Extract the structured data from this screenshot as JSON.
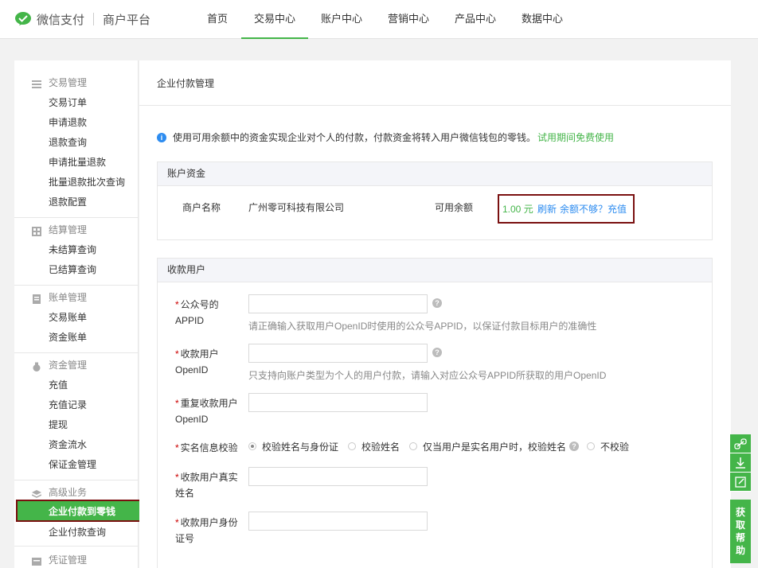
{
  "brand": {
    "name": "微信支付",
    "sub": "商户平台",
    "accent": "#44b549"
  },
  "nav": [
    "首页",
    "交易中心",
    "账户中心",
    "营销中心",
    "产品中心",
    "数据中心"
  ],
  "nav_active": "交易中心",
  "sidebar": {
    "groups": [
      {
        "title": "交易管理",
        "icon": "list-icon",
        "items": [
          "交易订单",
          "申请退款",
          "退款查询",
          "申请批量退款",
          "批量退款批次查询",
          "退款配置"
        ]
      },
      {
        "title": "结算管理",
        "icon": "grid-icon",
        "items": [
          "未结算查询",
          "已结算查询"
        ]
      },
      {
        "title": "账单管理",
        "icon": "bill-icon",
        "items": [
          "交易账单",
          "资金账单"
        ]
      },
      {
        "title": "资金管理",
        "icon": "money-bag-icon",
        "items": [
          "充值",
          "充值记录",
          "提现",
          "资金流水",
          "保证金管理"
        ]
      },
      {
        "title": "高级业务",
        "icon": "layers-icon",
        "items": [
          "企业付款到零钱",
          "企业付款查询"
        ]
      },
      {
        "title": "凭证管理",
        "icon": "voucher-icon",
        "items": []
      }
    ],
    "active_item": "企业付款到零钱"
  },
  "main": {
    "title": "企业付款管理",
    "info_text": "使用可用余额中的资金实现企业对个人的付款，付款资金将转入用户微信钱包的零钱。",
    "info_link": "试用期间免费使用",
    "account_panel": {
      "title": "账户资金",
      "merchant_label": "商户名称",
      "merchant_value": "广州零可科技有限公司",
      "balance_label": "可用余额",
      "balance_value": "1.00 元",
      "refresh": "刷新",
      "topup": "余额不够？充值"
    },
    "payee_panel": {
      "title": "收款用户",
      "fields": {
        "appid": {
          "label": "公众号的APPID",
          "hint": "请正确输入获取用户OpenID时使用的公众号APPID，以保证付款目标用户的准确性"
        },
        "openid": {
          "label": "收款用户OpenID",
          "hint": "只支持向账户类型为个人的用户付款，请输入对应公众号APPID所获取的用户OpenID"
        },
        "openid_repeat": {
          "label": "重复收款用户OpenID"
        },
        "realname_check": {
          "label": "实名信息校验",
          "options": [
            "校验姓名与身份证",
            "校验姓名",
            "仅当用户是实名用户时，校验姓名",
            "不校验"
          ],
          "selected": "校验姓名与身份证"
        },
        "real_name": {
          "label": "收款用户真实姓名"
        },
        "id_number": {
          "label": "收款用户身份证号"
        }
      }
    }
  },
  "float_tools": {
    "help": "获取帮助"
  }
}
